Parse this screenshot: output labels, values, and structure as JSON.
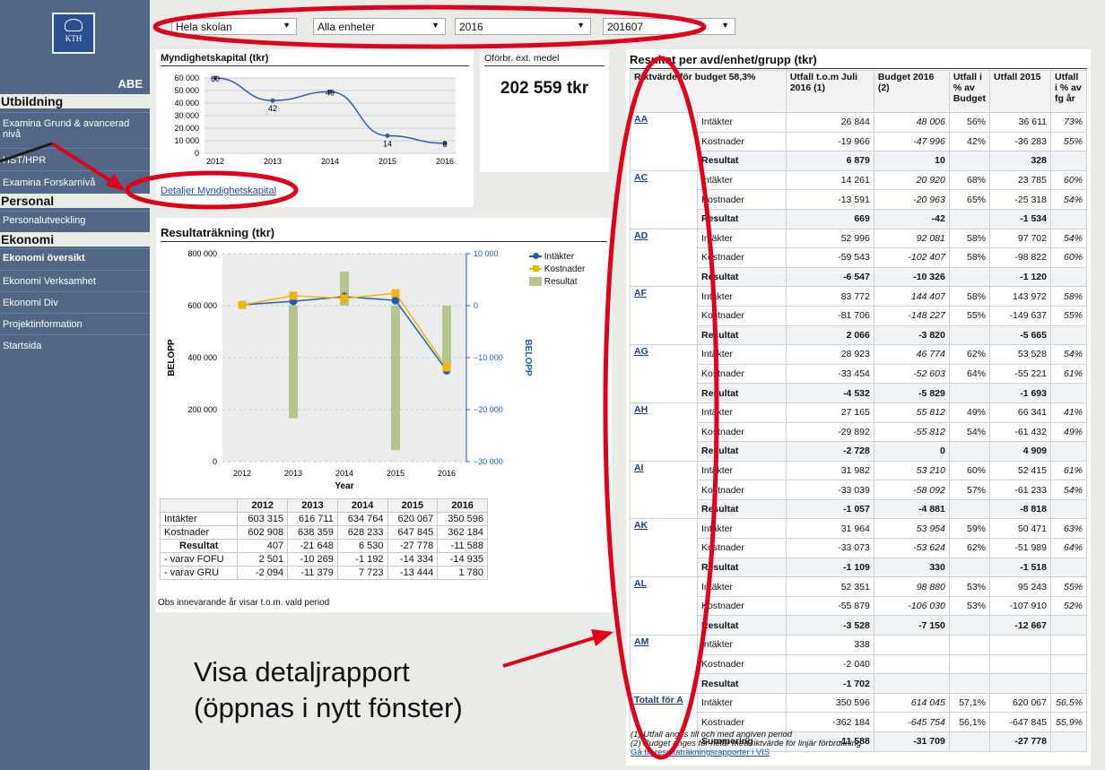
{
  "filters": [
    {
      "value": "Hela skolan"
    },
    {
      "value": "Alla enheter"
    },
    {
      "value": "2016"
    },
    {
      "value": "201607"
    }
  ],
  "sidebar": {
    "logo_text": "KTH",
    "org": "ABE",
    "sections": [
      {
        "heading": "Utbildning",
        "items": [
          {
            "label": "Examina Grund & avancerad nivå"
          },
          {
            "label": "HST/HPR"
          },
          {
            "label": "Examina Forskarnivå"
          }
        ]
      },
      {
        "heading": "Personal",
        "items": [
          {
            "label": "Personalutveckling"
          }
        ]
      },
      {
        "heading": "Ekonomi",
        "items": [
          {
            "label": "Ekonomi översikt"
          },
          {
            "label": "Ekonomi Verksamhet"
          },
          {
            "label": "Ekonomi Div"
          },
          {
            "label": "Projektinformation"
          },
          {
            "label": "Startsida"
          }
        ]
      }
    ]
  },
  "myndighet": {
    "title": "Myndighetskapital (tkr)",
    "link": "Detaljer Myndighetskapital",
    "chart_data": {
      "type": "line",
      "title": "Myndighetskapital (tkr)",
      "x": [
        "2012",
        "2013",
        "2014",
        "2015",
        "2016"
      ],
      "series": [
        {
          "values": [
            60000,
            42000,
            49000,
            14000,
            8000
          ]
        }
      ],
      "data_labels": [
        "60",
        "42",
        "49",
        "14",
        "8"
      ],
      "yticks": [
        "0",
        "10 000",
        "20 000",
        "30 000",
        "40 000",
        "50 000",
        "60 000"
      ],
      "ylim": [
        0,
        60000
      ]
    }
  },
  "oforbr": {
    "title": "Oförbr. ext. medel",
    "value": "202 559 tkr"
  },
  "resultat": {
    "title": "Resultaträkning (tkr)",
    "chart_data": {
      "type": "bar",
      "categories": [
        "2012",
        "2013",
        "2014",
        "2015",
        "2016"
      ],
      "xlabel": "Year",
      "ylabel": "BELOPP",
      "y2label": "BELOPP",
      "yticks": [
        "0",
        "200 000",
        "400 000",
        "600 000",
        "800 000"
      ],
      "y2ticks": [
        "10 000",
        "0",
        "−10 000",
        "−20 000",
        "−30 000"
      ],
      "ylim": [
        0,
        800000
      ],
      "y2lim": [
        -30000,
        10000
      ],
      "series": [
        {
          "name": "Intäkter",
          "type": "line",
          "axis": "left",
          "values": [
            603315,
            616711,
            634764,
            620067,
            350596
          ],
          "color": "#1a5fb4"
        },
        {
          "name": "Kostnader",
          "type": "line",
          "axis": "left",
          "values": [
            602908,
            638359,
            628233,
            647845,
            362184
          ],
          "color": "#f4b400"
        },
        {
          "name": "Resultat",
          "type": "bar",
          "axis": "right",
          "values": [
            407,
            -21648,
            6530,
            -27778,
            -11588
          ],
          "color": "#b5c68a"
        }
      ]
    },
    "table": {
      "columns": [
        "",
        "2012",
        "2013",
        "2014",
        "2015",
        "2016"
      ],
      "rows": [
        [
          "Intäkter",
          "603 315",
          "616 711",
          "634 764",
          "620 067",
          "350 596"
        ],
        [
          "Kostnader",
          "602 908",
          "638 359",
          "628 233",
          "647 845",
          "362 184"
        ],
        [
          "Resultat",
          "407",
          "-21 648",
          "6 530",
          "-27 778",
          "-11 588"
        ],
        [
          "- varav FOFU",
          "2 501",
          "-10 269",
          "-1 192",
          "-14 334",
          "-14 935"
        ],
        [
          "- varav GRU",
          "-2 094",
          "-11 379",
          "7 723",
          "-13 444",
          "1 780"
        ]
      ]
    },
    "note": "Obs innevarande år visar t.o.m. vald period"
  },
  "avd": {
    "title": "Resultat per avd/enhet/grupp (tkr)",
    "headers": [
      "Riktvärde för budget 58,3%",
      "Utfall t.o.m Juli 2016 (1)",
      "Budget 2016 (2)",
      "Utfall i % av Budget",
      "Utfall 2015",
      "Utfall i % av fg år"
    ],
    "units": [
      {
        "name": "AA",
        "rows": [
          [
            "Intäkter",
            "26 844",
            "48 006",
            "56%",
            "36 611",
            "73%"
          ],
          [
            "Kostnader",
            "-19 966",
            "-47 996",
            "42%",
            "-36 283",
            "55%"
          ],
          [
            "Resultat",
            "6 879",
            "10",
            "",
            "328",
            ""
          ]
        ]
      },
      {
        "name": "AC",
        "rows": [
          [
            "Intäkter",
            "14 261",
            "20 920",
            "68%",
            "23 785",
            "60%"
          ],
          [
            "Kostnader",
            "-13 591",
            "-20 963",
            "65%",
            "-25 318",
            "54%"
          ],
          [
            "Resultat",
            "669",
            "-42",
            "",
            "-1 534",
            ""
          ]
        ]
      },
      {
        "name": "AD",
        "rows": [
          [
            "Intäkter",
            "52 996",
            "92 081",
            "58%",
            "97 702",
            "54%"
          ],
          [
            "Kostnader",
            "-59 543",
            "-102 407",
            "58%",
            "-98 822",
            "60%"
          ],
          [
            "Resultat",
            "-6 547",
            "-10 326",
            "",
            "-1 120",
            ""
          ]
        ]
      },
      {
        "name": "AF",
        "rows": [
          [
            "Intäkter",
            "83 772",
            "144 407",
            "58%",
            "143 972",
            "58%"
          ],
          [
            "Kostnader",
            "-81 706",
            "-148 227",
            "55%",
            "-149 637",
            "55%"
          ],
          [
            "Resultat",
            "2 066",
            "-3 820",
            "",
            "-5 665",
            ""
          ]
        ]
      },
      {
        "name": "AG",
        "rows": [
          [
            "Intäkter",
            "28 923",
            "46 774",
            "62%",
            "53 528",
            "54%"
          ],
          [
            "Kostnader",
            "-33 454",
            "-52 603",
            "64%",
            "-55 221",
            "61%"
          ],
          [
            "Resultat",
            "-4 532",
            "-5 829",
            "",
            "-1 693",
            ""
          ]
        ]
      },
      {
        "name": "AH",
        "rows": [
          [
            "Intäkter",
            "27 165",
            "55 812",
            "49%",
            "66 341",
            "41%"
          ],
          [
            "Kostnader",
            "-29 892",
            "-55 812",
            "54%",
            "-61 432",
            "49%"
          ],
          [
            "Resultat",
            "-2 728",
            "0",
            "",
            "4 909",
            ""
          ]
        ]
      },
      {
        "name": "AI",
        "rows": [
          [
            "Intäkter",
            "31 982",
            "53 210",
            "60%",
            "52 415",
            "61%"
          ],
          [
            "Kostnader",
            "-33 039",
            "-58 092",
            "57%",
            "-61 233",
            "54%"
          ],
          [
            "Resultat",
            "-1 057",
            "-4 881",
            "",
            "-8 818",
            ""
          ]
        ]
      },
      {
        "name": "AK",
        "rows": [
          [
            "Intäkter",
            "31 964",
            "53 954",
            "59%",
            "50 471",
            "63%"
          ],
          [
            "Kostnader",
            "-33 073",
            "-53 624",
            "62%",
            "-51 989",
            "64%"
          ],
          [
            "Resultat",
            "-1 109",
            "330",
            "",
            "-1 518",
            ""
          ]
        ]
      },
      {
        "name": "AL",
        "rows": [
          [
            "Intäkter",
            "52 351",
            "98 880",
            "53%",
            "95 243",
            "55%"
          ],
          [
            "Kostnader",
            "-55 879",
            "-106 030",
            "53%",
            "-107 910",
            "52%"
          ],
          [
            "Resultat",
            "-3 528",
            "-7 150",
            "",
            "-12 667",
            ""
          ]
        ]
      },
      {
        "name": "AM",
        "rows": [
          [
            "Intäkter",
            "338",
            "",
            "",
            "",
            ""
          ],
          [
            "Kostnader",
            "-2 040",
            "",
            "",
            "",
            ""
          ],
          [
            "Resultat",
            "-1 702",
            "",
            "",
            "",
            ""
          ]
        ]
      },
      {
        "name": "Totalt för A",
        "rows": [
          [
            "Intäkter",
            "350 596",
            "614 045",
            "57,1%",
            "620 067",
            "56,5%"
          ],
          [
            "Kostnader",
            "-362 184",
            "-645 754",
            "56,1%",
            "-647 845",
            "55,9%"
          ],
          [
            "Summering",
            "-11 588",
            "-31 709",
            "",
            "-27 778",
            ""
          ]
        ]
      }
    ],
    "footnote1": "(1) Utfall anges till och med angiven period",
    "footnote2": "(2) Budget anges för helår med riktvärde för linjär förbrukning",
    "link": "Gå till resultaträkningsrapporter i VIS"
  },
  "annotation": {
    "line1": "Visa detaljrapport",
    "line2": "(öppnas i nytt fönster)"
  },
  "colors": {
    "sidebar": "#526785",
    "highlight": "#e0001a"
  }
}
